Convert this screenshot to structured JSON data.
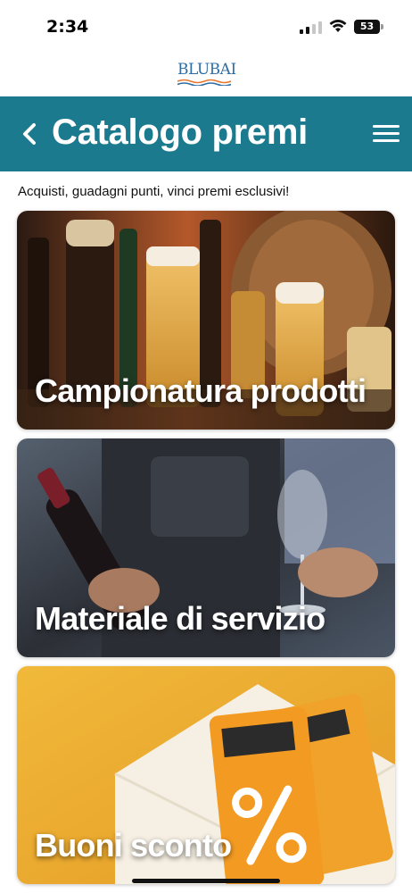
{
  "status_bar": {
    "time": "2:34",
    "battery": "53"
  },
  "logo": {
    "text": "BLUBAI"
  },
  "header": {
    "title": "Catalogo premi",
    "color": "#1c7a8f"
  },
  "subtitle": "Acquisti, guadagni punti, vinci premi esclusivi!",
  "cards": [
    {
      "label": "Campionatura prodotti",
      "image": "beer-bottles-and-glasses"
    },
    {
      "label": "Materiale di servizio",
      "image": "waiter-wine-bottle-glass"
    },
    {
      "label": "Buoni sconto",
      "image": "discount-coupons-envelope"
    }
  ]
}
